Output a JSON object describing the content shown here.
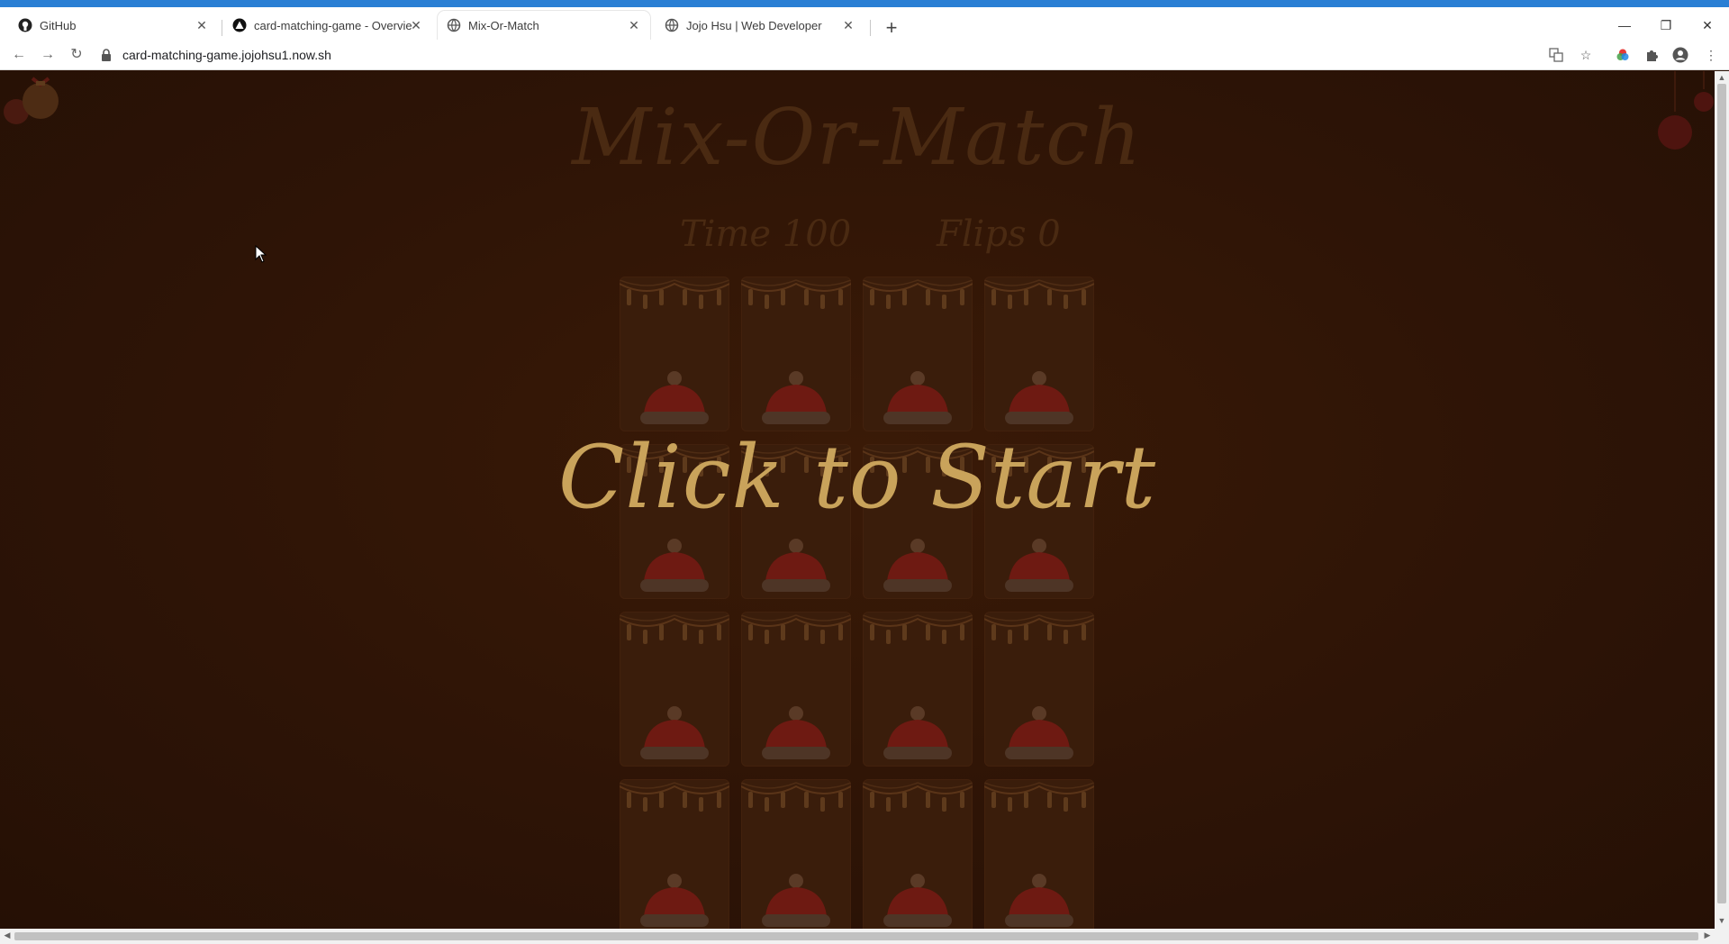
{
  "browser": {
    "tabs": [
      {
        "title": "GitHub",
        "icon": "github-icon",
        "active": false
      },
      {
        "title": "card-matching-game - Overvie",
        "icon": "vercel-icon",
        "active": false
      },
      {
        "title": "Mix-Or-Match",
        "icon": "globe-icon",
        "active": true
      },
      {
        "title": "Jojo Hsu | Web Developer",
        "icon": "globe-icon",
        "active": false
      }
    ],
    "url": "card-matching-game.jojohsu1.now.sh",
    "new_tab_label": "+",
    "close_glyph": "✕"
  },
  "game": {
    "title": "Mix-Or-Match",
    "time_label": "Time 100",
    "flips_label": "Flips 0",
    "overlay_text": "Click to Start",
    "card_count": 16
  },
  "colors": {
    "accent": "#c9a35b",
    "background": "#2e1406",
    "hat_red": "#6e1a12",
    "dim_text": "#4a2a12"
  }
}
